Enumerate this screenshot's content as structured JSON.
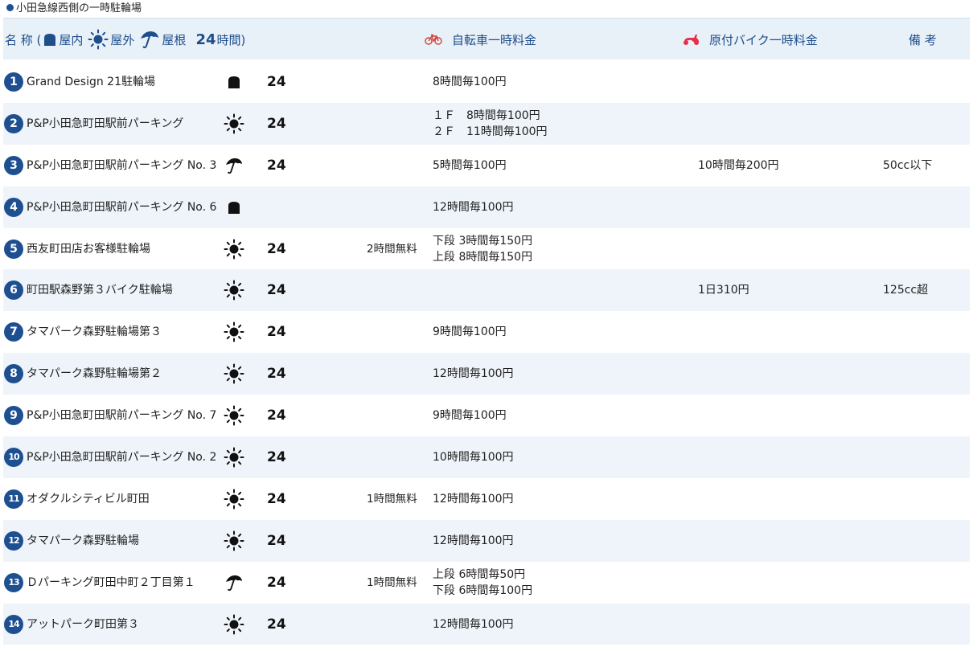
{
  "title": "小田急線西側の一時駐輪場",
  "header": {
    "name_label": "名 称 (",
    "indoor_label": "屋内",
    "outdoor_label": "屋外",
    "roof_label": "屋根",
    "hours_number": "24",
    "hours_label": "時間)",
    "bicycle_label": "自転車一時料金",
    "moped_label": "原付バイク一時料金",
    "notes_label": "備 考"
  },
  "colors": {
    "accent": "#1d4f91",
    "header_bg": "#e8f0f8",
    "row_alt_bg": "#eef4fa",
    "bike_icon": "#d0433a",
    "moped_icon": "#e5304a"
  },
  "rows": [
    {
      "num": "1",
      "name": "Grand Design 21駐輪場",
      "type": "indoor-icon",
      "hours": "24",
      "free": "",
      "bike": [
        "8時間毎100円"
      ],
      "moto": "",
      "note": ""
    },
    {
      "num": "2",
      "name": "P&P小田急町田駅前パーキング",
      "type": "sun-icon",
      "hours": "24",
      "free": "",
      "bike": [
        "１Ｆ　8時間毎100円",
        "２Ｆ　11時間毎100円"
      ],
      "moto": "",
      "note": ""
    },
    {
      "num": "3",
      "name": "P&P小田急町田駅前パーキング No. 3",
      "type": "umbrella-icon",
      "hours": "24",
      "free": "",
      "bike": [
        "5時間毎100円"
      ],
      "moto": "10時間毎200円",
      "note": "50cc以下"
    },
    {
      "num": "4",
      "name": "P&P小田急町田駅前パーキング No. 6",
      "type": "indoor-icon",
      "hours": "",
      "free": "",
      "bike": [
        "12時間毎100円"
      ],
      "moto": "",
      "note": ""
    },
    {
      "num": "5",
      "name": "西友町田店お客様駐輪場",
      "type": "sun-icon",
      "hours": "24",
      "free": "2時間無料",
      "bike": [
        "下段 3時間毎150円",
        "上段 8時間毎150円"
      ],
      "moto": "",
      "note": ""
    },
    {
      "num": "6",
      "name": "町田駅森野第３バイク駐輪場",
      "type": "sun-icon",
      "hours": "24",
      "free": "",
      "bike": [],
      "moto": "1日310円",
      "note": "125cc超"
    },
    {
      "num": "7",
      "name": "タマパーク森野駐輪場第３",
      "type": "sun-icon",
      "hours": "24",
      "free": "",
      "bike": [
        "9時間毎100円"
      ],
      "moto": "",
      "note": ""
    },
    {
      "num": "8",
      "name": "タマパーク森野駐輪場第２",
      "type": "sun-icon",
      "hours": "24",
      "free": "",
      "bike": [
        "12時間毎100円"
      ],
      "moto": "",
      "note": ""
    },
    {
      "num": "9",
      "name": "P&P小田急町田駅前パーキング No. 7",
      "type": "sun-icon",
      "hours": "24",
      "free": "",
      "bike": [
        "9時間毎100円"
      ],
      "moto": "",
      "note": ""
    },
    {
      "num": "10",
      "name": "P&P小田急町田駅前パーキング No. 2",
      "type": "sun-icon",
      "hours": "24",
      "free": "",
      "bike": [
        "10時間毎100円"
      ],
      "moto": "",
      "note": ""
    },
    {
      "num": "11",
      "name": "オダクルシティビル町田",
      "type": "sun-icon",
      "hours": "24",
      "free": "1時間無料",
      "bike": [
        "12時間毎100円"
      ],
      "moto": "",
      "note": ""
    },
    {
      "num": "12",
      "name": "タマパーク森野駐輪場",
      "type": "sun-icon",
      "hours": "24",
      "free": "",
      "bike": [
        "12時間毎100円"
      ],
      "moto": "",
      "note": ""
    },
    {
      "num": "13",
      "name": "Ｄパーキング町田中町２丁目第１",
      "type": "umbrella-icon",
      "hours": "24",
      "free": "1時間無料",
      "bike": [
        "上段 6時間毎50円",
        "下段 6時間毎100円"
      ],
      "moto": "",
      "note": ""
    },
    {
      "num": "14",
      "name": "アットパーク町田第３",
      "type": "sun-icon",
      "hours": "24",
      "free": "",
      "bike": [
        "12時間毎100円"
      ],
      "moto": "",
      "note": ""
    }
  ]
}
